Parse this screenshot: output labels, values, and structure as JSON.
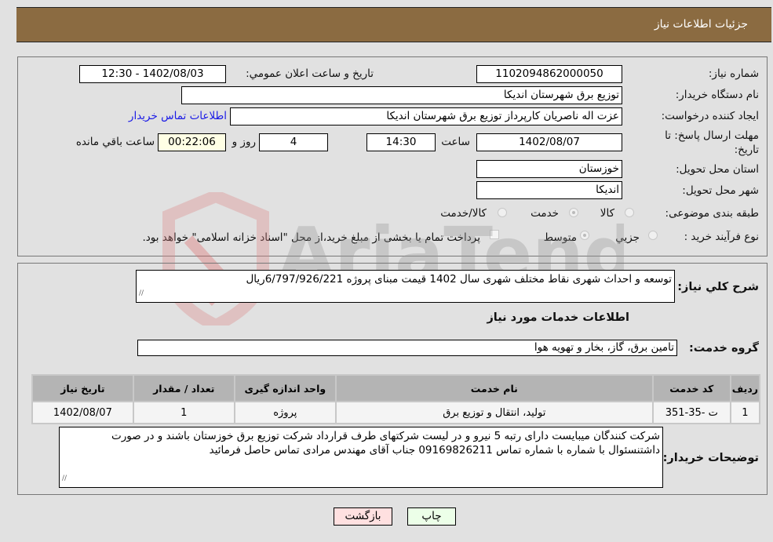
{
  "header": {
    "title": "جزئیات اطلاعات نیاز"
  },
  "form": {
    "need_number_label": "شماره نیاز:",
    "need_number": "1102094862000050",
    "announce_label": "تاریخ و ساعت اعلان عمومي:",
    "announce_value": "1402/08/03 - 12:30",
    "buyer_org_label": "نام دستگاه خریدار:",
    "buyer_org": "توزیع برق شهرستان اندیکا",
    "creator_label": "ایجاد کننده درخواست:",
    "creator": "عزت اله ناصریان کارپرداز توزیع برق شهرستان اندیکا",
    "contact_link": "اطلاعات تماس خریدار",
    "deadline_label": "مهلت ارسال پاسخ: تا تاریخ:",
    "deadline_date": "1402/08/07",
    "time_label": "ساعت",
    "deadline_time": "14:30",
    "days": "4",
    "days_label": "روز و",
    "remaining_time": "00:22:06",
    "remaining_label": "ساعت باقي مانده",
    "province_label": "استان محل تحویل:",
    "province": "خوزستان",
    "city_label": "شهر محل تحویل:",
    "city": "اندیکا",
    "category_label": "طبقه بندی موضوعی:",
    "category_options": [
      {
        "label": "کالا",
        "selected": false
      },
      {
        "label": "خدمت",
        "selected": true
      },
      {
        "label": "کالا/خدمت",
        "selected": false
      }
    ],
    "process_label": "نوع فرآیند خرید :",
    "process_options": [
      {
        "label": "جزيي",
        "selected": false
      },
      {
        "label": "متوسط",
        "selected": true
      }
    ],
    "treasury_checkbox_label": "پرداخت تمام یا بخشی از مبلغ خرید،از محل \"اسناد خزانه اسلامی\" خواهد بود."
  },
  "details": {
    "description_label": "شرح کلي نیاز:",
    "description": "توسعه و احداث شهری نقاط مختلف شهری سال 1402 قیمت مبنای پروژه 6/797/926/221ریال",
    "services_heading": "اطلاعات خدمات مورد نیاز",
    "service_group_label": "گروه خدمت:",
    "service_group": "تامین برق، گاز، بخار و تهویه هوا",
    "table": {
      "headers": [
        "ردیف",
        "کد خدمت",
        "نام خدمت",
        "واحد اندازه گیری",
        "تعداد / مقدار",
        "تاریخ نیاز"
      ],
      "rows": [
        [
          "1",
          "ت -35-351",
          "تولید، انتقال و توزیع برق",
          "پروژه",
          "1",
          "1402/08/07"
        ]
      ]
    },
    "buyer_notes_label": "توضیحات خریدار:",
    "buyer_notes": "شرکت کنندگان میبایست دارای رتبه 5 نیرو و در لیست شرکتهای طرف قرارداد شرکت توزیع برق خوزستان باشند و در صورت داشتنسئوال با شماره  با شماره تماس 09169826211 جناب آقای مهندس مرادی  تماس حاصل فرمائید"
  },
  "buttons": {
    "print": "چاپ",
    "back": "بازگشت"
  },
  "watermark": {
    "text": "AriaTender.neT"
  },
  "colors": {
    "header_bg": "#8b6b41",
    "print_bg": "#ecffe8",
    "back_bg": "#ffe0e0",
    "remaining_bg": "#ffffe5"
  }
}
